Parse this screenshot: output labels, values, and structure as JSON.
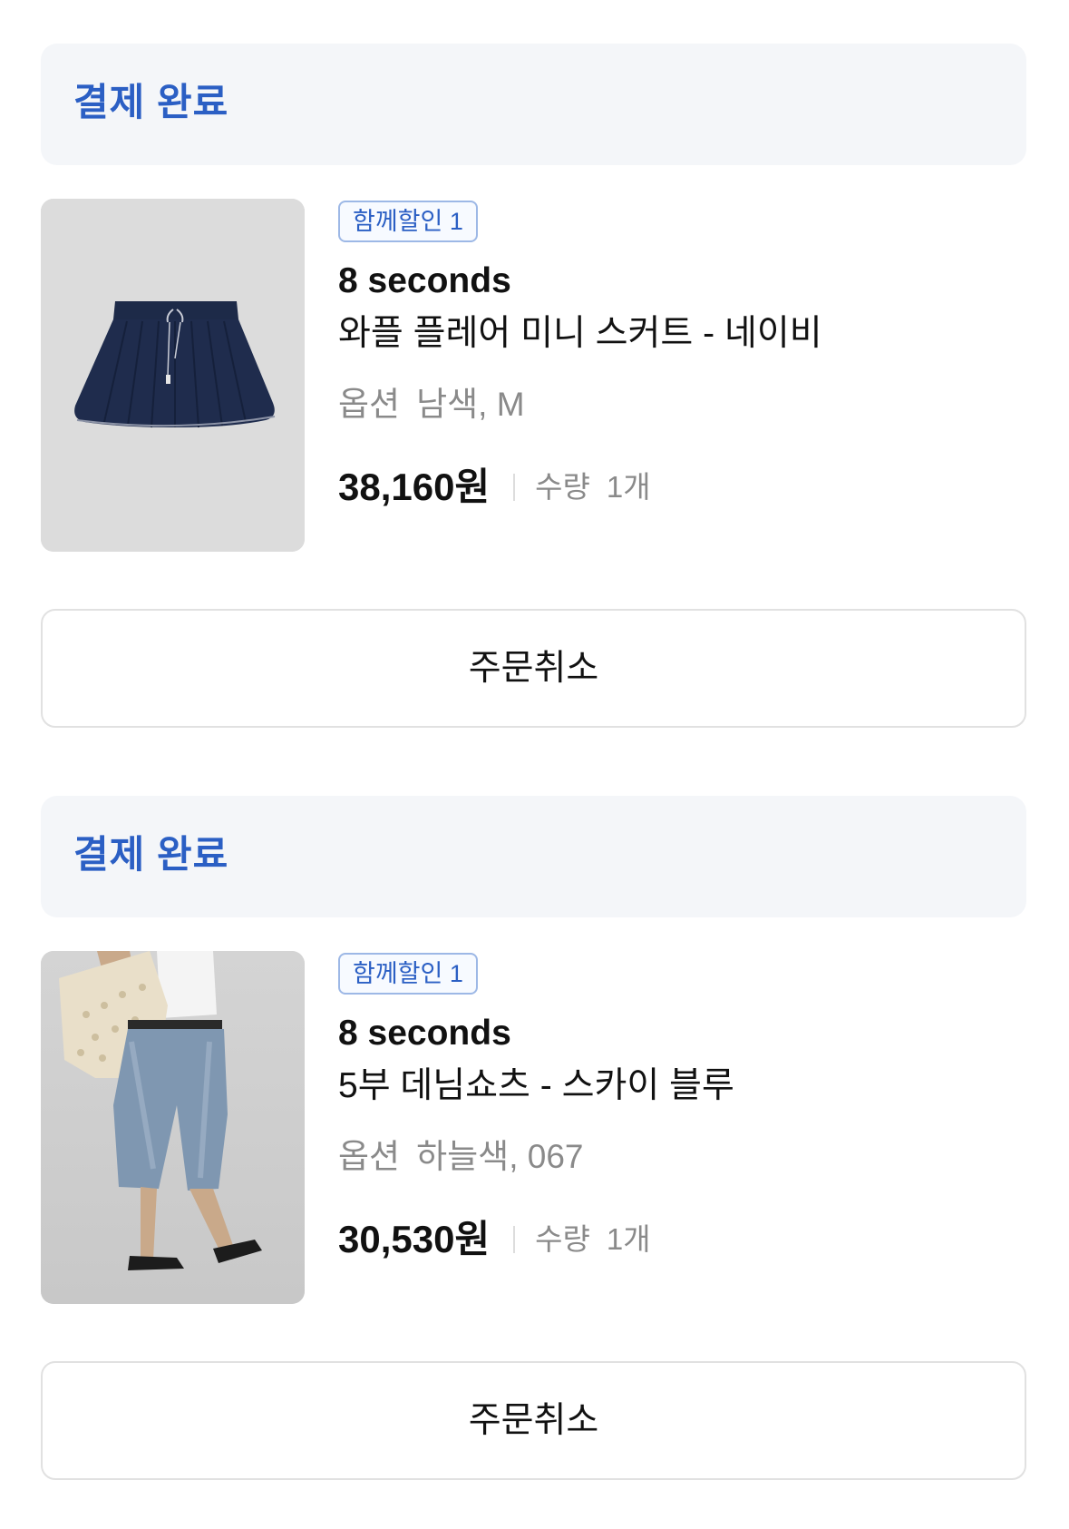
{
  "orders": [
    {
      "status": "결제 완료",
      "badge": "함께할인 1",
      "brand": "8 seconds",
      "product_name": "와플 플레어 미니 스커트 - 네이비",
      "option_label": "옵션",
      "option_value": "남색, M",
      "price": "38,160원",
      "qty_label": "수량",
      "qty_value": "1개",
      "cancel_label": "주문취소",
      "image": "navy-mini-skirt-photo"
    },
    {
      "status": "결제 완료",
      "badge": "함께할인 1",
      "brand": "8 seconds",
      "product_name": "5부 데님쇼츠 - 스카이 블루",
      "option_label": "옵션",
      "option_value": "하늘색, 067",
      "price": "30,530원",
      "qty_label": "수량",
      "qty_value": "1개",
      "cancel_label": "주문취소",
      "image": "denim-shorts-model-photo"
    }
  ],
  "colors": {
    "status_blue": "#2b5fc4",
    "status_bg": "#f4f6f9",
    "badge_border": "#9db8e6",
    "text_primary": "#111111",
    "text_secondary": "#8a8a8a",
    "button_border": "#e1e1e1"
  }
}
